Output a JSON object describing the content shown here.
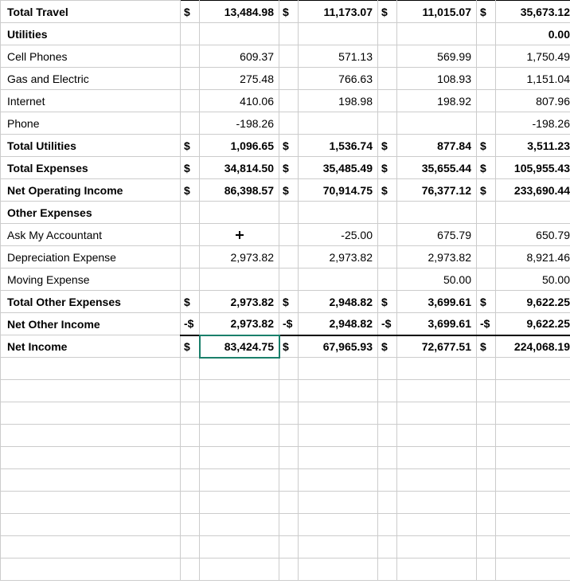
{
  "rows": [
    {
      "label": "Total Travel",
      "indent": 1,
      "bold": true,
      "topBorder": 1,
      "c1s": "$",
      "c1": "13,484.98",
      "c2s": "$",
      "c2": "11,173.07",
      "c3s": "$",
      "c3": "11,015.07",
      "c4s": "$",
      "c4": "35,673.12"
    },
    {
      "label": "Utilities",
      "indent": 1,
      "bold": true,
      "c1s": "",
      "c1": "",
      "c2s": "",
      "c2": "",
      "c3s": "",
      "c3": "",
      "c4s": "",
      "c4": "0.00"
    },
    {
      "label": "Cell Phones",
      "indent": 2,
      "c1s": "",
      "c1": "609.37",
      "c2s": "",
      "c2": "571.13",
      "c3s": "",
      "c3": "569.99",
      "c4s": "",
      "c4": "1,750.49"
    },
    {
      "label": "Gas and Electric",
      "indent": 2,
      "c1s": "",
      "c1": "275.48",
      "c2s": "",
      "c2": "766.63",
      "c3s": "",
      "c3": "108.93",
      "c4s": "",
      "c4": "1,151.04"
    },
    {
      "label": "Internet",
      "indent": 2,
      "c1s": "",
      "c1": "410.06",
      "c2s": "",
      "c2": "198.98",
      "c3s": "",
      "c3": "198.92",
      "c4s": "",
      "c4": "807.96"
    },
    {
      "label": "Phone",
      "indent": 2,
      "c1s": "",
      "c1": "-198.26",
      "c2s": "",
      "c2": "",
      "c3s": "",
      "c3": "",
      "c4s": "",
      "c4": "-198.26"
    },
    {
      "label": "Total Utilities",
      "indent": 1,
      "bold": true,
      "topBorder": 1,
      "c1s": "$",
      "c1": "1,096.65",
      "c2s": "$",
      "c2": "1,536.74",
      "c3s": "$",
      "c3": "877.84",
      "c4s": "$",
      "c4": "3,511.23"
    },
    {
      "label": "Total Expenses",
      "indent": 0,
      "bold": true,
      "topBorder": 1,
      "c1s": "$",
      "c1": "34,814.50",
      "c2s": "$",
      "c2": "35,485.49",
      "c3s": "$",
      "c3": "35,655.44",
      "c4s": "$",
      "c4": "105,955.43"
    },
    {
      "label": "Net Operating Income",
      "indent": 0,
      "bold": true,
      "topBorder": 1,
      "c1s": "$",
      "c1": "86,398.57",
      "c2s": "$",
      "c2": "70,914.75",
      "c3s": "$",
      "c3": "76,377.12",
      "c4s": "$",
      "c4": "233,690.44"
    },
    {
      "label": "Other Expenses",
      "indent": 0,
      "bold": true,
      "c1s": "",
      "c1": "",
      "c2s": "",
      "c2": "",
      "c3s": "",
      "c3": "",
      "c4s": "",
      "c4": ""
    },
    {
      "label": "Ask My Accountant",
      "indent": 1,
      "cursor": true,
      "c1s": "",
      "c1": "",
      "c2s": "",
      "c2": "-25.00",
      "c3s": "",
      "c3": "675.79",
      "c4s": "",
      "c4": "650.79"
    },
    {
      "label": "Depreciation Expense",
      "indent": 1,
      "c1s": "",
      "c1": "2,973.82",
      "c2s": "",
      "c2": "2,973.82",
      "c3s": "",
      "c3": "2,973.82",
      "c4s": "",
      "c4": "8,921.46"
    },
    {
      "label": "Moving Expense",
      "indent": 1,
      "c1s": "",
      "c1": "",
      "c2s": "",
      "c2": "",
      "c3s": "",
      "c3": "50.00",
      "c4s": "",
      "c4": "50.00"
    },
    {
      "label": "Total Other Expenses",
      "indent": 0,
      "bold": true,
      "topBorder": 1,
      "c1s": "$",
      "c1": "2,973.82",
      "c2s": "$",
      "c2": "2,948.82",
      "c3s": "$",
      "c3": "3,699.61",
      "c4s": "$",
      "c4": "9,622.25"
    },
    {
      "label": "Net Other Income",
      "indent": 0,
      "bold": true,
      "topBorder": 1,
      "c1s": "-$",
      "c1": "2,973.82",
      "c2s": "-$",
      "c2": "2,948.82",
      "c3s": "-$",
      "c3": "3,699.61",
      "c4s": "-$",
      "c4": "9,622.25"
    },
    {
      "label": "Net Income",
      "indent": 0,
      "bold": true,
      "topBorder": 2,
      "selected": true,
      "c1s": "$",
      "c1": "83,424.75",
      "c2s": "$",
      "c2": "67,965.93",
      "c3s": "$",
      "c3": "72,677.51",
      "c4s": "$",
      "c4": "224,068.19"
    }
  ],
  "blank_rows": 10
}
